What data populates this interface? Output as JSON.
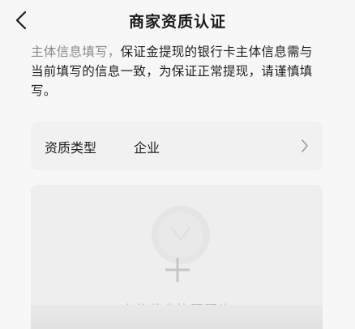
{
  "header": {
    "title": "商家资质认证",
    "back_icon": "chevron-left-icon"
  },
  "notice": {
    "lead": "主体信息填写，",
    "body": "保证金提现的银行卡主体信息需与当前填写的信息一致，为保证正常提现，请谨慎填写。"
  },
  "qualification": {
    "label": "资质类型",
    "value": "企业",
    "chevron_icon": "chevron-right-icon"
  },
  "upload": {
    "label": "上传营业执照照片",
    "icons": [
      "license-placeholder-icon",
      "plus-icon"
    ]
  },
  "colors": {
    "background": "#f7f7f7",
    "card": "#f1f1f1",
    "lead_text": "#8a8a8a",
    "placeholder_text": "#b3b3b3"
  }
}
